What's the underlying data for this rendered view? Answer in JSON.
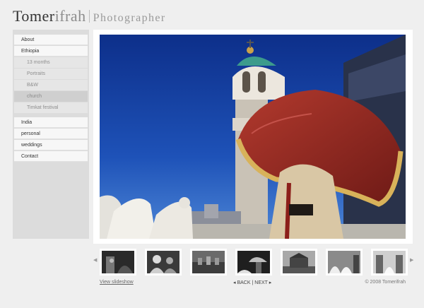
{
  "header": {
    "first_name": "Tomer",
    "last_name": "ifrah",
    "tagline": "Photographer"
  },
  "sidebar": {
    "items": [
      {
        "label": "About",
        "level": "top"
      },
      {
        "label": "Ethiopia",
        "level": "top"
      },
      {
        "label": "13 months",
        "level": "sub"
      },
      {
        "label": "Portraits",
        "level": "sub"
      },
      {
        "label": "B&W",
        "level": "sub"
      },
      {
        "label": "church",
        "level": "sub",
        "active": true
      },
      {
        "label": "Timkat festival",
        "level": "sub"
      },
      {
        "label": "India",
        "level": "top"
      },
      {
        "label": "personal",
        "level": "top"
      },
      {
        "label": "weddings",
        "level": "top"
      },
      {
        "label": "Contact",
        "level": "top"
      }
    ]
  },
  "thumbnails": {
    "prev_icon": "chevron-left-icon",
    "next_icon": "chevron-right-icon",
    "count": 7
  },
  "footer": {
    "slideshow_label": "View slideshow",
    "back_label": "BACK",
    "separator": "|",
    "next_label": "NEXT",
    "copyright": "© 2008 Tomerifrah"
  },
  "colors": {
    "background": "#efefef",
    "sidebar": "#dcdcdc",
    "sky": "#1e4fb4",
    "umbrella": "#9c2a24",
    "fringe": "#d8b25a"
  }
}
